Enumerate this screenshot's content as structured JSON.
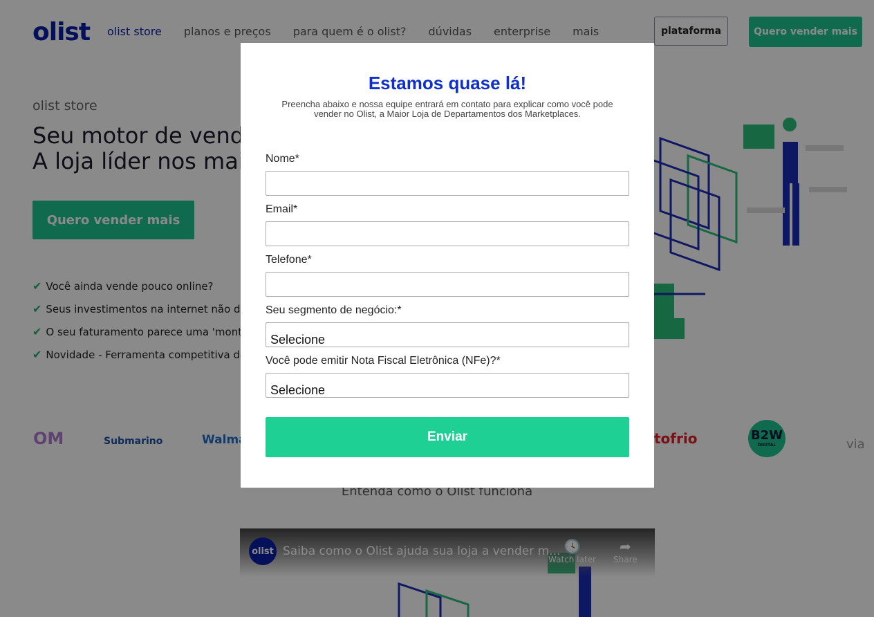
{
  "header": {
    "logo": "olist",
    "nav": [
      "olist store",
      "planos e preços",
      "para quem é o olist?",
      "dúvidas",
      "enterprise",
      "mais"
    ],
    "platform_button": "plataforma",
    "cta_button": "Quero vender mais"
  },
  "hero": {
    "eyebrow": "olist store",
    "title_line1": "Seu motor de vendas",
    "title_line2": "A loja líder nos maior",
    "cta": "Quero vender mais",
    "checks": [
      "Você ainda vende pouco online?",
      "Seus investimentos na internet não de",
      "O seu faturamento parece uma 'monta",
      "Novidade - Ferramenta competitiva de"
    ]
  },
  "logos": {
    "items": [
      "OM",
      "Submarino",
      "Walma",
      "tofrio",
      "B2W",
      "DIGITAL",
      "via"
    ]
  },
  "section_title": "Entenda como o Olist funciona",
  "video": {
    "channel": "olist",
    "title": "Saiba como o Olist ajuda sua loja a vender m...",
    "watch_later": "Watch later",
    "share": "Share"
  },
  "modal": {
    "title": "Estamos quase lá!",
    "subtitle": "Preencha abaixo e nossa equipe entrará em contato para explicar como você pode vender no Olist, a Maior Loja de Departamentos dos Marketplaces.",
    "fields": {
      "name_label": "Nome*",
      "email_label": "Email*",
      "phone_label": "Telefone*",
      "segment_label": "Seu segmento de negócio:*",
      "segment_value": "Selecione",
      "nfe_label": "Você pode emitir Nota Fiscal Eletrônica (NFe)?*",
      "nfe_value": "Selecione"
    },
    "submit": "Enviar"
  },
  "colors": {
    "brand_blue": "#0a1fa8",
    "brand_green": "#1fc590",
    "modal_title": "#1130c9",
    "send_button": "#1fd095"
  }
}
